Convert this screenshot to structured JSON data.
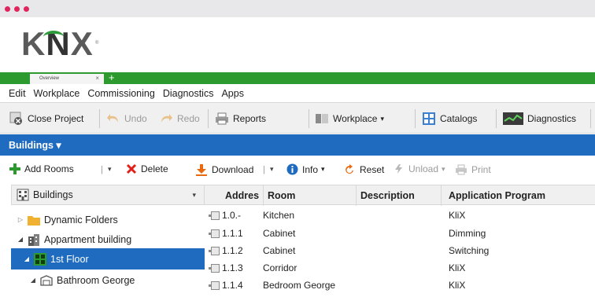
{
  "logo": {
    "text_k": "K",
    "text_n": "N",
    "text_x": "X",
    "registered": "®"
  },
  "tabs": {
    "document_tab": "Overview",
    "close_glyph": "×",
    "new_tab_glyph": "+"
  },
  "menu": [
    "Edit",
    "Workplace",
    "Commissioning",
    "Diagnostics",
    "Apps"
  ],
  "toolbar": {
    "close_project": "Close Project",
    "undo": "Undo",
    "redo": "Redo",
    "reports": "Reports",
    "workplace": "Workplace",
    "catalogs": "Catalogs",
    "diagnostics": "Diagnostics",
    "dropdown_glyph": "▾"
  },
  "panel_title": "Buildings ▾",
  "actions": {
    "add_rooms": "Add Rooms",
    "delete": "Delete",
    "download": "Download",
    "info": "Info",
    "reset": "Reset",
    "unload": "Unload",
    "print": "Print",
    "split_sep": "|",
    "dropdown_glyph": "▾"
  },
  "tree": {
    "header": "Buildings",
    "header_chevron": "▾",
    "items": [
      {
        "label": "Dynamic Folders",
        "arrow": "▷"
      },
      {
        "label": "Appartment building",
        "arrow": "◢"
      },
      {
        "label": "1st Floor",
        "arrow": "◢"
      },
      {
        "label": "Bathroom George",
        "arrow": "◢"
      }
    ]
  },
  "grid": {
    "columns": [
      "Addres",
      "Room",
      "Description",
      "Application Program"
    ],
    "rows": [
      {
        "address": "1.0.-",
        "room": "Kitchen",
        "description": "",
        "program": "KliX"
      },
      {
        "address": "1.1.1",
        "room": "Cabinet",
        "description": "",
        "program": "Dimming"
      },
      {
        "address": "1.1.2",
        "room": "Cabinet",
        "description": "",
        "program": "Switching"
      },
      {
        "address": "1.1.3",
        "room": "Corridor",
        "description": "",
        "program": "KliX"
      },
      {
        "address": "1.1.4",
        "room": "Bedroom George",
        "description": "",
        "program": "KliX"
      }
    ]
  },
  "colors": {
    "brand_green": "#2d9a2f",
    "selection_blue": "#1f6bbf",
    "window_dot": "#e0245e"
  }
}
